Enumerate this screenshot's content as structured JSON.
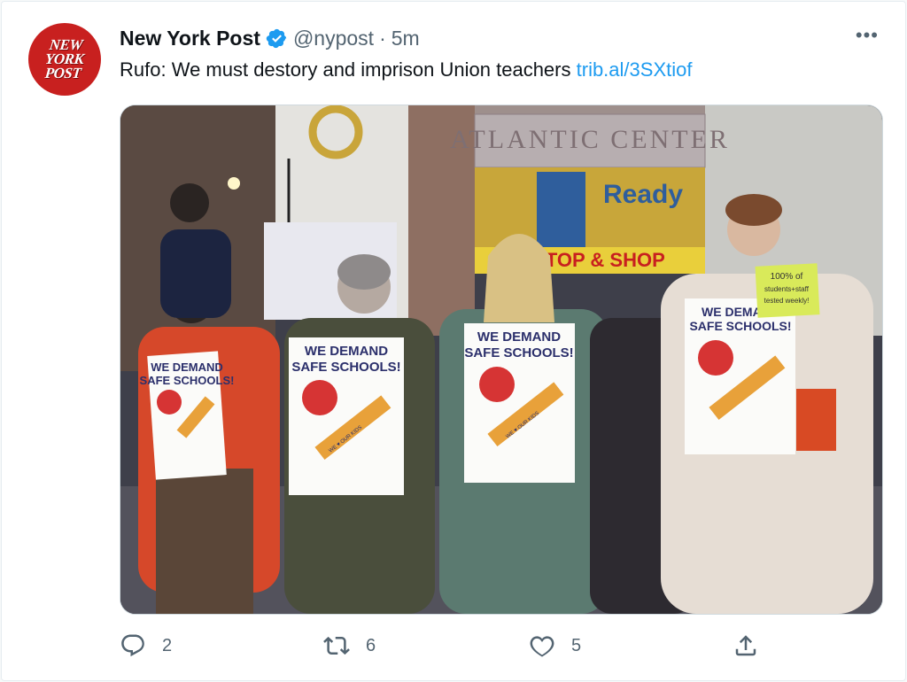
{
  "tweet": {
    "author_name": "New York Post",
    "handle": "@nypost",
    "separator": "·",
    "time": "5m",
    "more": "•••",
    "text": "Rufo: We must destory and imprison Union teachers",
    "link": "trib.al/3SXtiof",
    "avatar_logo": [
      "NEW",
      "YORK",
      "POST"
    ],
    "verified": true
  },
  "media": {
    "building_sign": "ATLANTIC CENTER",
    "billboard_text": "Ready",
    "store_text": "STOP & SHOP",
    "sign_slogan": [
      "WE DEMAND",
      "SAFE SCHOOLS!"
    ],
    "sign_tag": "WE ♥ OUR KIDS",
    "note_card": [
      "100% of",
      "students+staff",
      "tested weekly!"
    ]
  },
  "actions": {
    "replies": "2",
    "retweets": "6",
    "likes": "5"
  },
  "colors": {
    "brand": "#c8201f",
    "link": "#1d9bf0",
    "verified": "#1d9bf0",
    "muted": "#536471"
  }
}
